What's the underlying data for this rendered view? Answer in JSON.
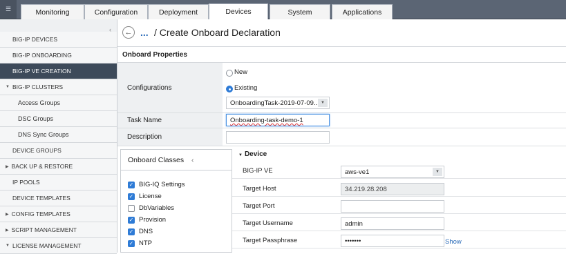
{
  "topnav": {
    "logo_icon": "filter-icon",
    "logo_glyph": "☰",
    "tabs": [
      "Monitoring",
      "Configuration",
      "Deployment",
      "Devices",
      "System",
      "Applications"
    ],
    "active_tab": "Devices"
  },
  "sidebar": {
    "items": [
      {
        "label": "BIG-IP DEVICES"
      },
      {
        "label": "BIG-IP ONBOARDING"
      },
      {
        "label": "BIG-IP VE CREATION"
      },
      {
        "label": "BIG-IP CLUSTERS"
      },
      {
        "label": "Access Groups"
      },
      {
        "label": "DSC Groups"
      },
      {
        "label": "DNS Sync Groups"
      },
      {
        "label": "DEVICE GROUPS"
      },
      {
        "label": "BACK UP & RESTORE"
      },
      {
        "label": "IP POOLS"
      },
      {
        "label": "DEVICE TEMPLATES"
      },
      {
        "label": "CONFIG TEMPLATES"
      },
      {
        "label": "SCRIPT MANAGEMENT"
      },
      {
        "label": "LICENSE MANAGEMENT"
      }
    ]
  },
  "header": {
    "back_glyph": "←",
    "crumb": "...",
    "title": "/ Create Onboard Declaration"
  },
  "section": {
    "title": "Onboard Properties"
  },
  "properties": {
    "configurations_label": "Configurations",
    "radio_new": "New",
    "radio_existing": "Existing",
    "existing_select": "OnboardingTask-2019-07-09...",
    "task_name_label": "Task Name",
    "task_name_value": "Onboarding-task-demo-1",
    "description_label": "Description",
    "description_value": ""
  },
  "onboard_classes": {
    "title": "Onboard Classes",
    "items": [
      {
        "label": "BIG-IQ Settings",
        "checked": true
      },
      {
        "label": "License",
        "checked": true
      },
      {
        "label": "DbVariables",
        "checked": false
      },
      {
        "label": "Provision",
        "checked": true
      },
      {
        "label": "DNS",
        "checked": true
      },
      {
        "label": "NTP",
        "checked": true
      }
    ]
  },
  "device": {
    "title": "Device",
    "rows": [
      {
        "label": "BIG-IP VE",
        "value": "aws-ve1"
      },
      {
        "label": "Target Host",
        "value": "34.219.28.208"
      },
      {
        "label": "Target Port",
        "value": ""
      },
      {
        "label": "Target Username",
        "value": "admin"
      },
      {
        "label": "Target Passphrase",
        "value": "•••••••"
      }
    ],
    "show_link": "Show"
  },
  "colors": {
    "accent": "#2e7bd6",
    "nav_bg": "#5b6574",
    "active_side": "#3d4a5a"
  }
}
